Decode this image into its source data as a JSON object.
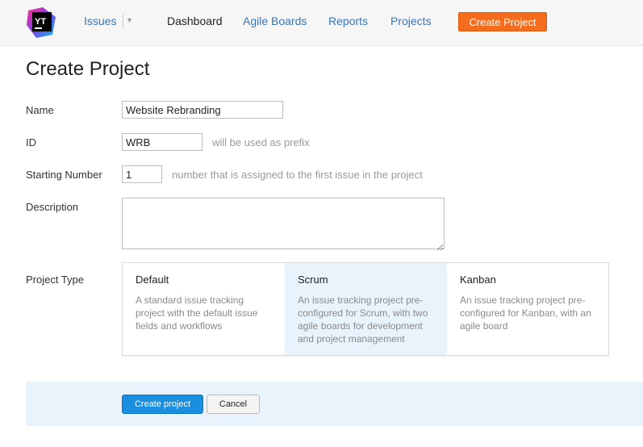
{
  "app": {
    "logo_text": "YT",
    "brand_colors": [
      "#f46d1f",
      "#1a8fe0",
      "#7b3fe4",
      "#ff318c"
    ]
  },
  "nav": {
    "issues": "Issues",
    "dashboard": "Dashboard",
    "agile_boards": "Agile Boards",
    "reports": "Reports",
    "projects": "Projects",
    "create_project": "Create Project"
  },
  "page": {
    "title": "Create Project"
  },
  "form": {
    "name": {
      "label": "Name",
      "value": "Website Rebranding"
    },
    "id": {
      "label": "ID",
      "value": "WRB",
      "hint": "will be used as prefix"
    },
    "starting_number": {
      "label": "Starting Number",
      "value": "1",
      "hint": "number that is assigned to the first issue in the project"
    },
    "description": {
      "label": "Description",
      "value": ""
    },
    "project_type": {
      "label": "Project Type",
      "selected": "Scrum",
      "options": [
        {
          "title": "Default",
          "description": "A standard issue tracking project with the default issue fields and workflows"
        },
        {
          "title": "Scrum",
          "description": "An issue tracking project pre-configured for Scrum, with two agile boards for development and project management"
        },
        {
          "title": "Kanban",
          "description": "An issue tracking project pre-configured for Kanban, with an agile board"
        }
      ]
    }
  },
  "actions": {
    "create": "Create project",
    "cancel": "Cancel"
  },
  "colors": {
    "accent_orange": "#f46d1f",
    "primary_blue": "#1a8fe0",
    "link_blue": "#3b74b6",
    "selected_bg": "#e8f3fb"
  }
}
